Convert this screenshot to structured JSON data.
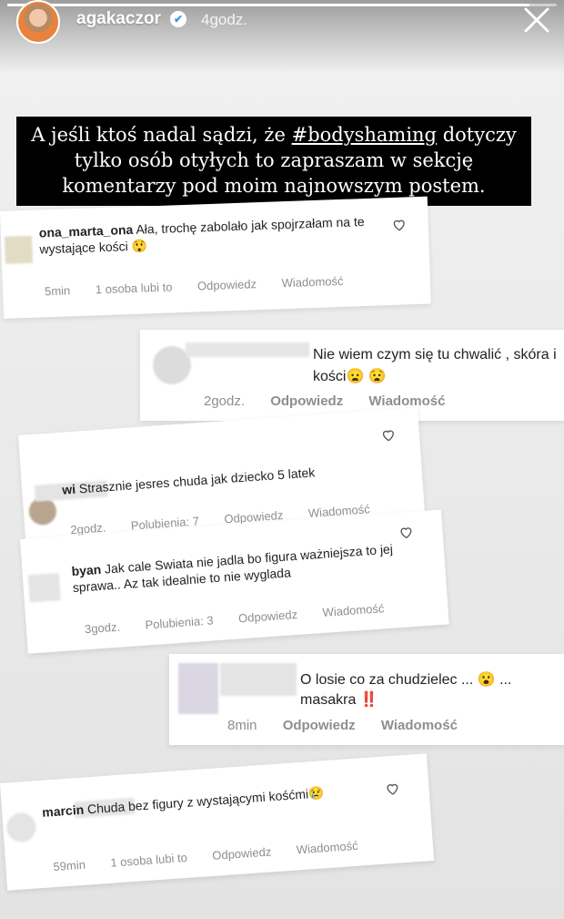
{
  "story": {
    "username": "agakaczor",
    "time_ago": "4godz.",
    "progress": 0.95,
    "caption_before": "A jeśli ktoś nadal sądzi, że ",
    "caption_hashtag": "#bodyshaming",
    "caption_after": " dotyczy tylko osób otyłych to zapraszam w sekcję komentarzy pod moim najnowszym postem."
  },
  "comments": [
    {
      "handle": "ona_marta_ona",
      "text": "Ała, trochę zabolało jak spojrzałam na te wystające kości 😲",
      "time": "5min",
      "likes": "1 osoba lubi to",
      "reply": "Odpowiedz",
      "message": "Wiadomość"
    },
    {
      "handle": "",
      "text": "Nie wiem czym się tu chwalić , skóra i kości😦 😧",
      "time": "2godz.",
      "reply": "Odpowiedz",
      "message": "Wiadomość"
    },
    {
      "handle": "wi",
      "text": "Strasznie jesres chuda jak dziecko 5 latek",
      "time": "2godz.",
      "likes": "Polubienia: 7",
      "reply": "Odpowiedz",
      "message": "Wiadomość"
    },
    {
      "handle": "byan",
      "text": "Jak cale Swiata nie jadla bo figura ważniejsza to jej sprawa.. Az tak idealnie to nie wyglada",
      "time": "3godz.",
      "likes": "Polubienia: 3",
      "reply": "Odpowiedz",
      "message": "Wiadomość"
    },
    {
      "handle": "",
      "text": "O losie co za chudzielec ... 😮 ... masakra ‼️",
      "time": "8min",
      "reply": "Odpowiedz",
      "message": "Wiadomość"
    },
    {
      "handle": "marcin",
      "text": "Chuda bez figury z wystającymi kośćmi😢",
      "time": "59min",
      "likes": "1 osoba lubi to",
      "reply": "Odpowiedz",
      "message": "Wiadomość"
    }
  ]
}
